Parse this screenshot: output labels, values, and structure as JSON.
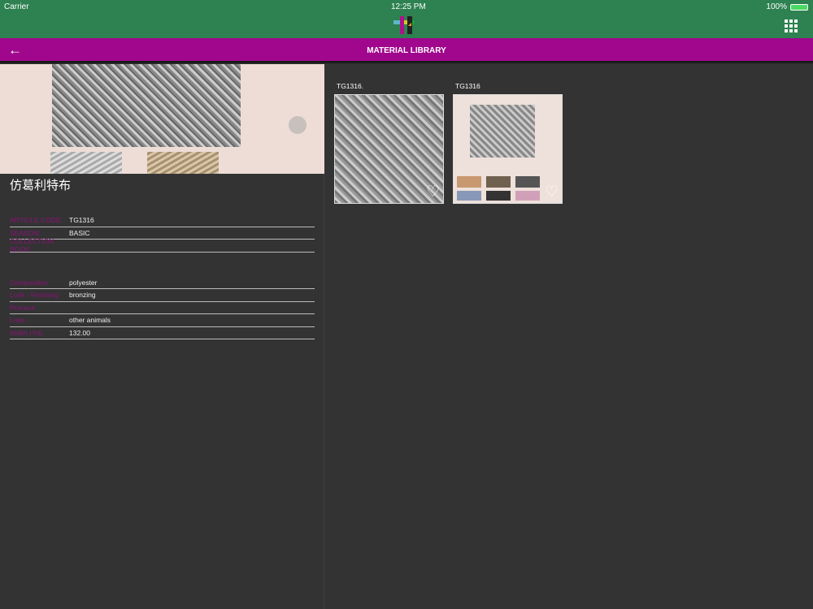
{
  "status": {
    "carrier": "Carrier",
    "time": "12:25 PM",
    "battery": "100%"
  },
  "nav": {
    "title": "MATERIAL LIBRARY"
  },
  "product": {
    "name": "仿葛利特布",
    "fields1": [
      {
        "label": "ARTICLE CODE:",
        "value": "TG1316"
      },
      {
        "label": "SEASON:",
        "value": "BASIC"
      },
      {
        "label": "COLLECTION BOOK:",
        "value": ""
      }
    ],
    "fields2": [
      {
        "label": "Composition",
        "value": "polyester"
      },
      {
        "label": "Look - Finishing",
        "value": "bronzing"
      },
      {
        "label": "Process",
        "value": ""
      },
      {
        "label": "Look",
        "value": "other animals"
      },
      {
        "label": "Width (Yd)",
        "value": "132.00"
      }
    ]
  },
  "gallery": [
    {
      "title": "TG1316."
    },
    {
      "title": "TG1316"
    }
  ]
}
